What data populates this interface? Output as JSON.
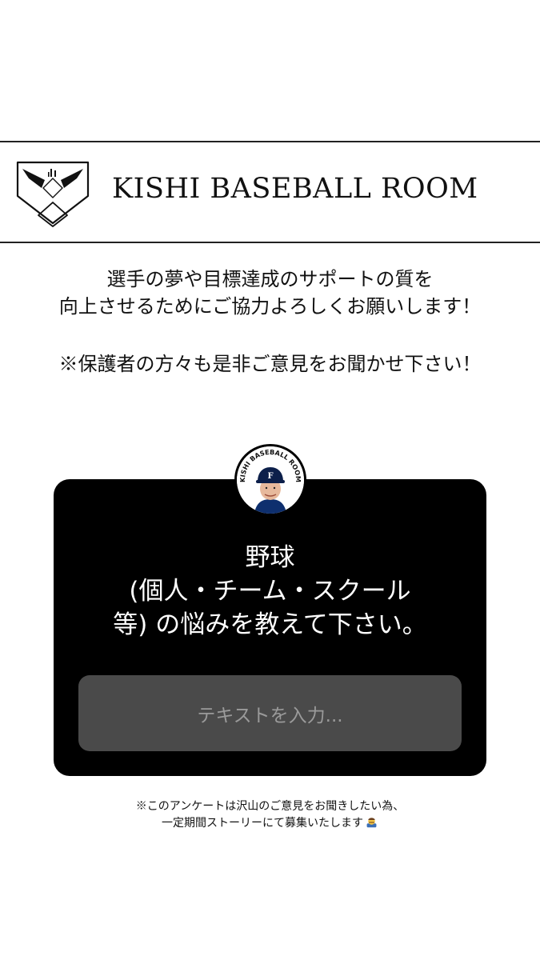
{
  "header": {
    "brand_name": "KISHI BASEBALL ROOM",
    "logo_icon": "baseball-diamond-face-logo"
  },
  "intro": {
    "line1": "選手の夢や目標達成のサポートの質を",
    "line2": "向上させるためにご協力よろしくお願いします！",
    "line3": "※保護者の方々も是非ご意見をお聞かせ下さい！"
  },
  "question_sticker": {
    "avatar_ring_text": "KISHI BASEBALL ROOM",
    "avatar_cap_letter": "F",
    "question_line1": "野球",
    "question_line2": "(個人・チーム・スクール",
    "question_line3": "等) の悩みを教えて下さい。",
    "input_placeholder": "テキストを入力...",
    "colors": {
      "card_background": "#000000",
      "input_background": "#4a4a4a",
      "question_text": "#ffffff",
      "placeholder_text": "#9a9a9a"
    }
  },
  "footer_note": {
    "line1": "※このアンケートは沢山のご意見をお聞きしたい為、",
    "line2": "一定期間ストーリーにて募集いたします",
    "emoji_icon": "bowing-person-emoji"
  }
}
